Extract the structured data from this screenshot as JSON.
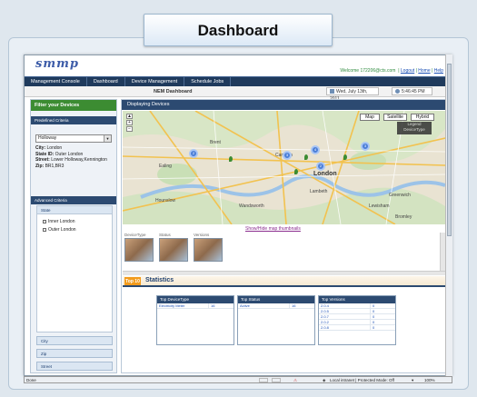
{
  "slide": {
    "title": "Dashboard"
  },
  "header": {
    "logo": "smmp",
    "welcome_text": "Welcome 172206@cts.com",
    "links": [
      "Logout",
      "Home",
      "Help"
    ]
  },
  "nav": {
    "items": [
      "Management Console",
      "Dashboard",
      "Device Management",
      "Schedule Jobs"
    ]
  },
  "subbar": {
    "title": "NEM Dashboard",
    "date": "Wed, July 13th, 2011",
    "time": "5:46:45 PM"
  },
  "left": {
    "filter_title": "Filter your Devices",
    "predefined_title": "Predefined Criteria",
    "selected_criteria": "Holloway",
    "info": {
      "city_label": "City:",
      "city": "London",
      "state_label": "State ID:",
      "state": "Outer London",
      "street_label": "Street:",
      "street": "Lower Holloway,Kennington",
      "zip_label": "Zip:",
      "zip": "BR1,BR3"
    },
    "advanced_title": "Advanced Criteria",
    "state_section": "State",
    "state_options": [
      "Inner London",
      "Outer London"
    ],
    "accordion": [
      "City",
      "Zip",
      "Street"
    ]
  },
  "main": {
    "displaying_title": "Displaying Devices",
    "map_types": [
      "Map",
      "Satellite",
      "Hybrid"
    ],
    "legend": [
      "Legend",
      "DeviceType"
    ],
    "map_labels": [
      "London",
      "Brent",
      "Hounslow",
      "Wandsworth",
      "Lambeth",
      "Greenwich",
      "Lewisham",
      "Camden",
      "Ealing",
      "Bromley"
    ],
    "show_hide": "Show/Hide map thumbnails",
    "thumb_labels": [
      "DeviceType",
      "Status",
      "Versions"
    ],
    "top10": "Top 10",
    "stats_title": "Statistics"
  },
  "stats": {
    "tables": [
      {
        "header": "Top DeviceType",
        "rows": [
          {
            "name": "Electricity Meter",
            "value": "16"
          }
        ]
      },
      {
        "header": "Top Status",
        "rows": [
          {
            "name": "Active",
            "value": "16"
          }
        ]
      },
      {
        "header": "Top Versions",
        "rows": [
          {
            "name": "2.0.4",
            "value": "0"
          },
          {
            "name": "2.0.5",
            "value": "0"
          },
          {
            "name": "2.0.7",
            "value": "0"
          },
          {
            "name": "2.0.2",
            "value": "0"
          },
          {
            "name": "2.0.8",
            "value": "0"
          }
        ]
      }
    ]
  },
  "statusbar": {
    "left": "Done",
    "zone": "Local intranet | Protected Mode: Off",
    "zoom": "100%"
  },
  "colors": {
    "accent_green": "#3c8c32",
    "nav_blue": "#1f3a5c",
    "top10_orange": "#f29b1c"
  }
}
